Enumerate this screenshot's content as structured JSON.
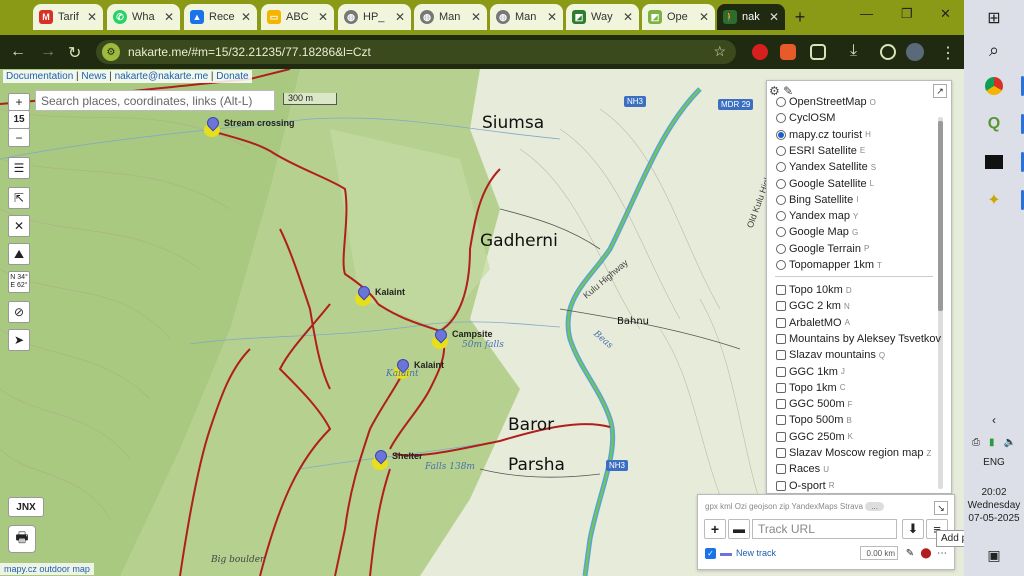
{
  "browser": {
    "tabs": [
      {
        "title": "Tarif",
        "icon": "gmail-icon",
        "color": "#d93025"
      },
      {
        "title": "Wha",
        "icon": "whatsapp-icon",
        "color": "#25d366"
      },
      {
        "title": "Rece",
        "icon": "google-drive-icon",
        "color": "#1a73e8"
      },
      {
        "title": "ABC",
        "icon": "slides-icon",
        "color": "#f4b400"
      },
      {
        "title": "HP_",
        "icon": "globe-icon",
        "color": "#777777"
      },
      {
        "title": "Man",
        "icon": "globe-icon",
        "color": "#777777"
      },
      {
        "title": "Man",
        "icon": "globe-icon",
        "color": "#777777"
      },
      {
        "title": "Way",
        "icon": "map-icon",
        "color": "#2e7d32"
      },
      {
        "title": "Ope",
        "icon": "map-icon",
        "color": "#7cb342"
      },
      {
        "title": "nak",
        "icon": "hiker-icon",
        "color": "#222222"
      }
    ],
    "new_tab": "+",
    "minimize": "—",
    "restore": "❐",
    "close": "✕",
    "url": "nakarte.me/#m=15/32.21235/77.18286&l=Czt"
  },
  "map": {
    "links": {
      "documentation": "Documentation",
      "news": "News",
      "email": "nakarte@nakarte.me",
      "donate": "Donate"
    },
    "search_placeholder": "Search places, coordinates, links (Alt-L)",
    "scale": "300 m",
    "zoom_in": "+",
    "zoom_level": "15",
    "zoom_out": "−",
    "coords": "N 34°\nE 62°",
    "jnx": "JNX",
    "attribution": "mapy.cz outdoor map",
    "places": [
      "Siumsa",
      "Gadherni",
      "Baror",
      "Parsha",
      "Bahnu"
    ],
    "points": {
      "stream_crossing": "Stream crossing",
      "kalaint1": "Kalaint",
      "campsite": "Campsite",
      "kalaint2": "Kalaint",
      "shelter": "Shelter"
    },
    "labels": {
      "falls50": "50m falls",
      "falls138": "Falls 138m",
      "big_boulder": "Big boulder",
      "kalaint_blue": "Kalaint",
      "kulu_highway": "Kulu Highway",
      "old_kulu": "Old Kulu Highway",
      "beas": "Beas"
    },
    "shields": {
      "nh3a": "NH3",
      "nh3b": "NH3",
      "mdr": "MDR 29"
    }
  },
  "layers_panel": {
    "base_layers": [
      {
        "label": "OpenStreetMap",
        "key": "O",
        "selected": false
      },
      {
        "label": "CyclOSM",
        "key": "",
        "selected": false
      },
      {
        "label": "mapy.cz tourist",
        "key": "H",
        "selected": true
      },
      {
        "label": "ESRI Satellite",
        "key": "E",
        "selected": false
      },
      {
        "label": "Yandex Satellite",
        "key": "S",
        "selected": false
      },
      {
        "label": "Google Satellite",
        "key": "L",
        "selected": false
      },
      {
        "label": "Bing Satellite",
        "key": "I",
        "selected": false
      },
      {
        "label": "Yandex map",
        "key": "Y",
        "selected": false
      },
      {
        "label": "Google Map",
        "key": "G",
        "selected": false
      },
      {
        "label": "Google Terrain",
        "key": "P",
        "selected": false
      },
      {
        "label": "Topomapper 1km",
        "key": "T",
        "selected": false
      }
    ],
    "overlays": [
      {
        "label": "Topo 10km",
        "key": "D"
      },
      {
        "label": "GGC 2 km",
        "key": "N"
      },
      {
        "label": "ArbaletMO",
        "key": "A"
      },
      {
        "label": "Mountains by Aleksey Tsvetkov",
        "key": ""
      },
      {
        "label": "Slazav mountains",
        "key": "Q"
      },
      {
        "label": "GGC 1km",
        "key": "J"
      },
      {
        "label": "Topo 1km",
        "key": "C"
      },
      {
        "label": "GGC 500m",
        "key": "F"
      },
      {
        "label": "Topo 500m",
        "key": "B"
      },
      {
        "label": "GGC 250m",
        "key": "K"
      },
      {
        "label": "Slazav Moscow region map",
        "key": "Z"
      },
      {
        "label": "Races",
        "key": "U"
      },
      {
        "label": "O-sport",
        "key": "R"
      }
    ]
  },
  "track_panel": {
    "formats": "gpx kml Ozi geojson zip YandexMaps Strava",
    "pill": "...",
    "url_placeholder": "Track URL",
    "track_name": "New track",
    "track_length": "0.00 km",
    "tooltip": "Add point",
    "track_color": "#6b74d8"
  },
  "taskbar": {
    "time": "20:02",
    "day": "Wednesday",
    "date": "07-05-2025",
    "lang": "ENG",
    "notifications": "1"
  }
}
